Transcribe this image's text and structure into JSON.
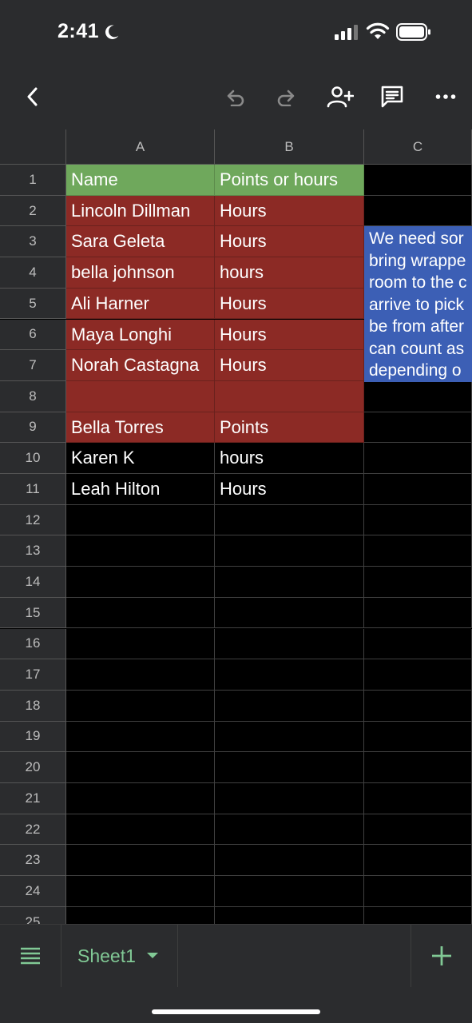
{
  "status": {
    "time": "2:41"
  },
  "columns": [
    "A",
    "B",
    "C"
  ],
  "rows": [
    "1",
    "2",
    "3",
    "4",
    "5",
    "6",
    "7",
    "8",
    "9",
    "10",
    "11",
    "12",
    "13",
    "14",
    "15",
    "16",
    "17",
    "18",
    "19",
    "20",
    "21",
    "22",
    "23",
    "24",
    "25"
  ],
  "cells": [
    [
      "Name",
      "Points or hours"
    ],
    [
      "Lincoln Dillman",
      "Hours"
    ],
    [
      "Sara Geleta",
      "Hours"
    ],
    [
      " bella johnson",
      "hours"
    ],
    [
      "Ali Harner",
      "Hours"
    ],
    [
      "Maya Longhi",
      "Hours"
    ],
    [
      "Norah Castagna",
      "Hours"
    ],
    [
      "",
      ""
    ],
    [
      "Bella Torres",
      "Points"
    ],
    [
      "Karen K",
      "hours"
    ],
    [
      "Leah Hilton",
      "Hours"
    ]
  ],
  "note_cell": {
    "lines": [
      "We need sor",
      "bring wrappe",
      "room to the c",
      "arrive to pick",
      "be from after",
      "can count as",
      "depending o"
    ]
  },
  "colors": {
    "header_green": "#6fa85c",
    "row_red": "#8c2a25",
    "note_blue": "#3c5fb5",
    "sheet_tab_green": "#81c995"
  },
  "sheet_bar": {
    "active_sheet": "Sheet1"
  },
  "icons": [
    "back-icon",
    "undo-icon",
    "redo-icon",
    "add-person-icon",
    "comment-icon",
    "more-icon",
    "menu-icon",
    "dropdown-icon",
    "add-icon",
    "moon-icon",
    "signal-icon",
    "wifi-icon",
    "battery-icon"
  ]
}
